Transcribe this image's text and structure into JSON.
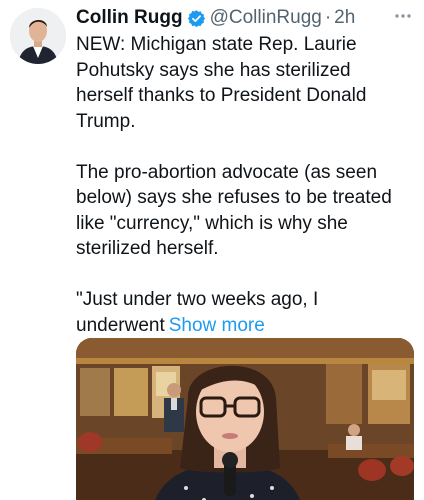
{
  "tweet": {
    "author_name": "Collin Rugg",
    "handle": "@CollinRugg",
    "separator": "·",
    "time": "2h",
    "verified_icon": "verified-badge-icon",
    "more_icon": "more-dots-icon",
    "paragraphs": [
      [
        "NEW: Michigan state Rep. Laurie",
        "Pohutsky says she has sterilized",
        "herself thanks to President Donald",
        "Trump."
      ],
      [
        "The pro-abortion advocate (as seen",
        "below) says she refuses to be treated",
        "like \"currency,\" which is why she",
        "sterilized herself."
      ],
      [
        "\"Just under two weeks ago, I",
        "underwent"
      ]
    ],
    "show_more": "Show more",
    "colors": {
      "text": "#0f1419",
      "secondary": "#536471",
      "link": "#1d9bf0",
      "verified": "#1d9bf0"
    }
  }
}
